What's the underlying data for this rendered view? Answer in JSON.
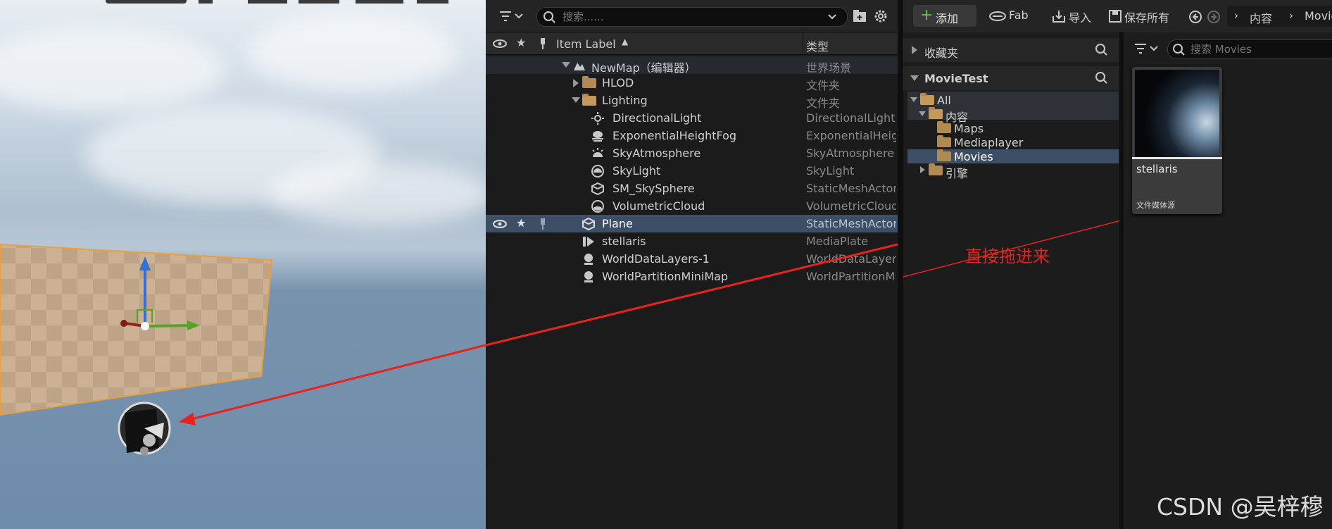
{
  "outliner": {
    "search_placeholder": "搜索......",
    "header": {
      "label": "Item Label",
      "type": "类型"
    },
    "rows": [
      {
        "label": "NewMap（编辑器）",
        "type": "世界场景"
      },
      {
        "label": "HLOD",
        "type": "文件夹"
      },
      {
        "label": "Lighting",
        "type": "文件夹"
      },
      {
        "label": "DirectionalLight",
        "type": "DirectionalLight"
      },
      {
        "label": "ExponentialHeightFog",
        "type": "ExponentialHeightFog"
      },
      {
        "label": "SkyAtmosphere",
        "type": "SkyAtmosphere"
      },
      {
        "label": "SkyLight",
        "type": "SkyLight"
      },
      {
        "label": "SM_SkySphere",
        "type": "StaticMeshActor"
      },
      {
        "label": "VolumetricCloud",
        "type": "VolumetricCloud"
      },
      {
        "label": "Plane",
        "type": "StaticMeshActor"
      },
      {
        "label": "stellaris",
        "type": "MediaPlate"
      },
      {
        "label": "WorldDataLayers-1",
        "type": "WorldDataLayers"
      },
      {
        "label": "WorldPartitionMiniMap",
        "type": "WorldPartitionMiniMap"
      }
    ]
  },
  "toolbar": {
    "add": "添加",
    "fab": "Fab",
    "import": "导入",
    "save_all": "保存所有",
    "breadcrumb": [
      "内容",
      "Movies"
    ]
  },
  "sources": {
    "favorites": "收藏夹",
    "project": "MovieTest",
    "tree": {
      "all": "All",
      "content": "内容",
      "maps": "Maps",
      "mediaplayer": "Mediaplayer",
      "movies": "Movies",
      "engine": "引擎"
    }
  },
  "content_browser": {
    "search_placeholder": "搜索 Movies",
    "asset": {
      "name": "stellaris",
      "type": "文件媒体源"
    }
  },
  "annotation": "直接拖进来",
  "watermark": "CSDN @吴梓穆",
  "colors": {
    "selection": "#3d4f66",
    "annotation": "#e8231f"
  }
}
